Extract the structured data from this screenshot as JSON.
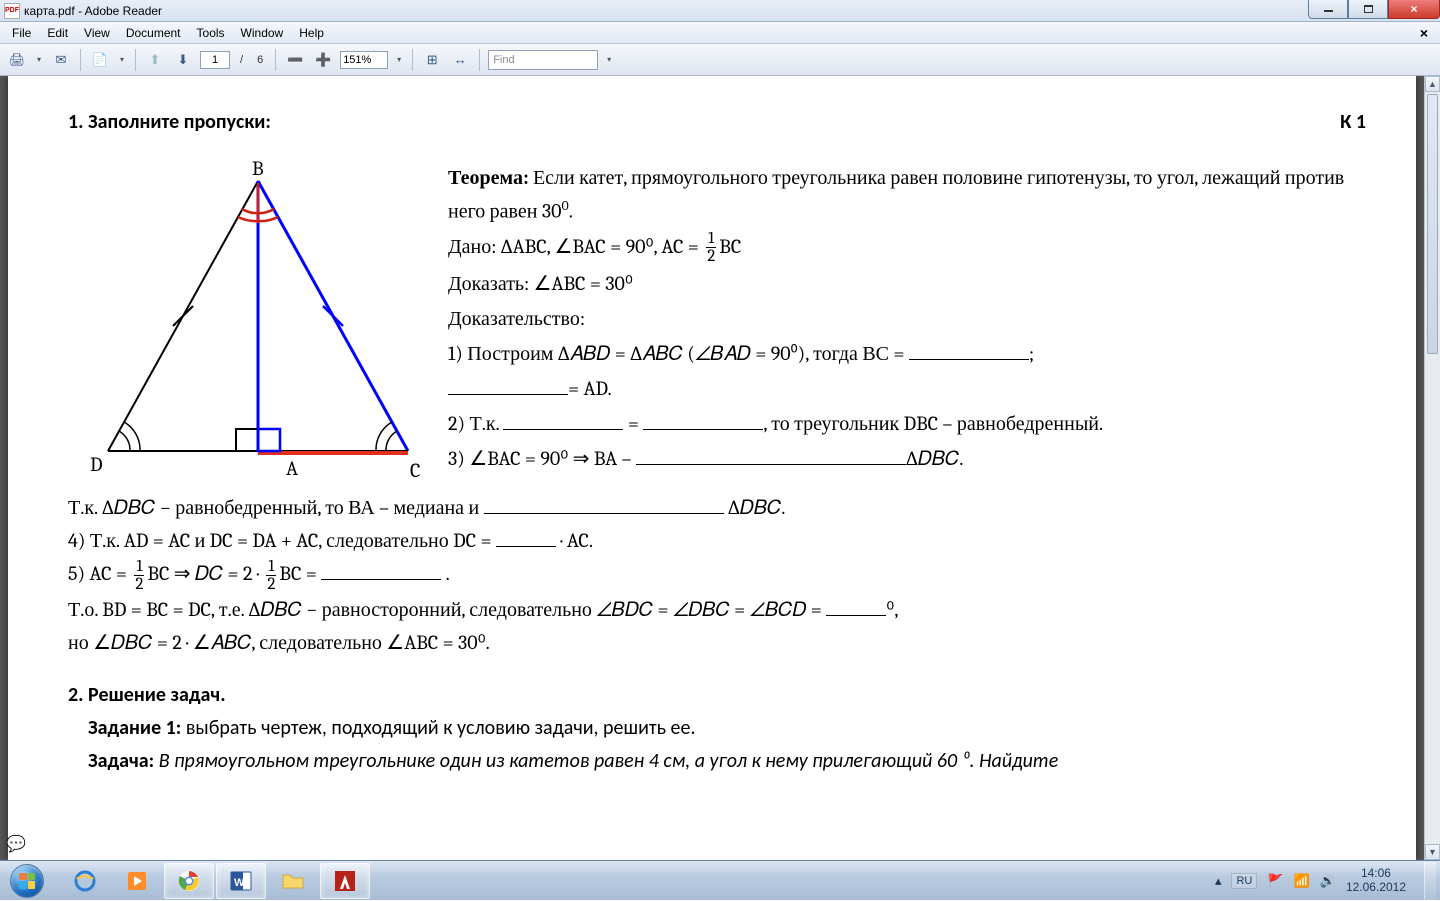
{
  "window": {
    "title": "карта.pdf - Adobe Reader"
  },
  "menu": {
    "file": "File",
    "edit": "Edit",
    "view": "View",
    "document": "Document",
    "tools": "Tools",
    "window": "Window",
    "help": "Help",
    "closeX": "×"
  },
  "toolbar": {
    "page_current": "1",
    "page_sep": "/",
    "page_total": "6",
    "zoom": "151%",
    "find_placeholder": "Find"
  },
  "doc": {
    "heading": "1. Заполните пропуски:",
    "variant": "К 1",
    "theorem_label": "Теорема:",
    "theorem": "Если катет, прямоугольного треугольника равен половине гипотенузы, то угол, лежащий против него равен 30",
    "given_label": "Дано:",
    "given": "∆ABC, ∠BAC = 90⁰, AC = ",
    "given_tail": "BC",
    "prove_label": "Доказать:",
    "prove": "∠ABC = 30⁰",
    "proof_label": "Доказательство:",
    "step1a": "1) Построим ∆𝐴𝐵𝐷 = ∆𝐴𝐵𝐶 (∠𝐵𝐴𝐷 = 90⁰), тогда ВС = ",
    "step1b": "= AD.",
    "step2a": "2) Т.к. ",
    "step2b": " = ",
    "step2c": ", то треугольник DBC – равнобедренный.",
    "step3a": "3) ∠BAC = 90⁰ ⇒ BA – ",
    "step3b": "∆𝐷𝐵𝐶.",
    "step3c": "Т.к. ∆𝐷𝐵𝐶 − равнобедренный, то ВА – медиана и ",
    "step3d": " ∆𝐷𝐵𝐶.",
    "step4a": "4) Т.к. AD = AC и DC = DA + AC, следовательно DC = ",
    "step4b": " · AC.",
    "step5a": "5) AC = ",
    "step5b": "BC  ⇒  𝐷𝐶 = 2 · ",
    "step5c": "BC = ",
    "step5d": " .",
    "concl_a": "Т.о. BD = BC = DC, т.е. ∆𝐷𝐵𝐶 − равносторонний, следовательно ∠𝐵𝐷𝐶 =  ∠𝐷𝐵𝐶 =  ∠𝐵𝐶𝐷 =  ",
    "concl_b": "⁰,",
    "concl_c": "но ∠𝐷𝐵𝐶 =  2 · ∠𝐴𝐵𝐶, следовательно ∠ABC = 30⁰.",
    "sec2": "2. Решение задач.",
    "task1_label": "Задание 1:",
    "task1": " выбрать чертеж, подходящий к условию задачи, решить ее.",
    "task_label": "Задача:",
    "task": " В прямоугольном треугольнике один из катетов равен 4 см, а угол к нему прилегающий 60 ⁰. Найдите",
    "vertex_B": "B",
    "vertex_A": "A",
    "vertex_C": "C",
    "vertex_D": "D",
    "semicolon": ";"
  },
  "tray": {
    "lang": "RU",
    "time": "14:06",
    "date": "12.06.2012"
  }
}
